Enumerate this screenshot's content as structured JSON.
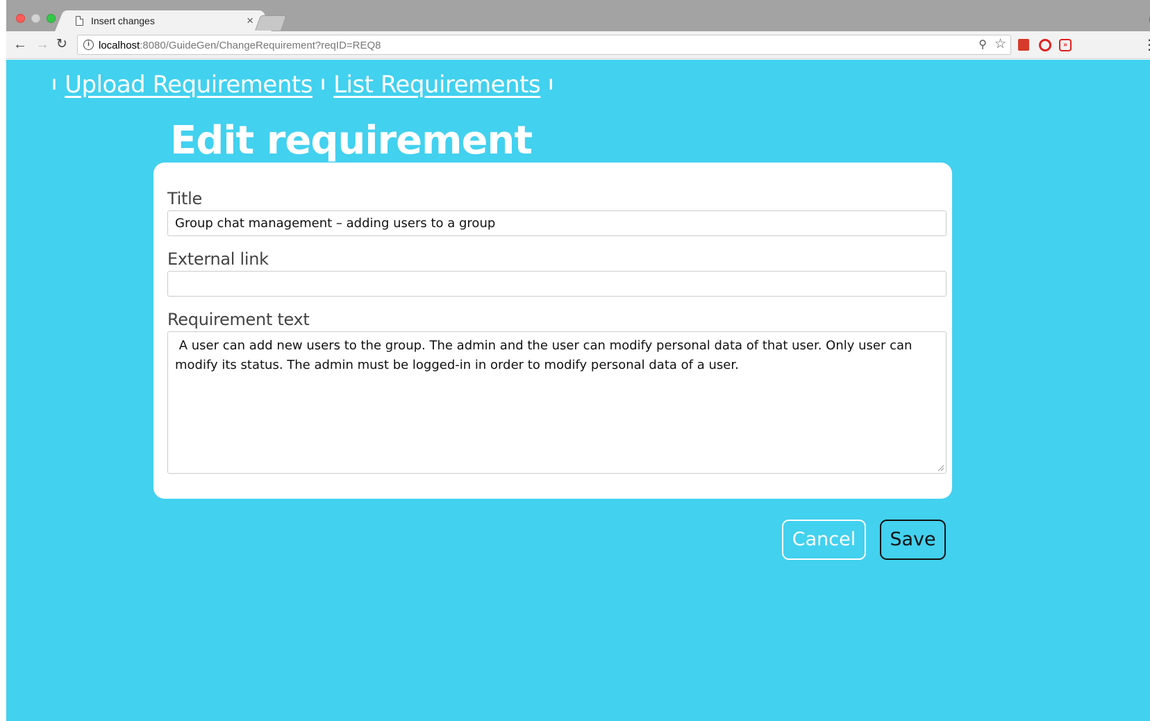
{
  "browser": {
    "tab_title": "Insert changes",
    "tab_close": "×",
    "url_host": "localhost",
    "url_rest": ":8080/GuideGen/ChangeRequirement?reqID=REQ8",
    "info_glyph": "i",
    "profile_glyph": "e",
    "ext3_glyph": "»"
  },
  "nav": {
    "separator": "I",
    "links": [
      "Upload Requirements",
      "List Requirements"
    ]
  },
  "page": {
    "heading": "Edit requirement",
    "form": {
      "title_label": "Title",
      "title_value": "Group chat management – adding users to a group",
      "link_label": "External link",
      "link_value": "",
      "text_label": "Requirement text",
      "text_value": " A user can add new users to the group. The admin and the user can modify personal data of that user. Only user can modify its status. The admin must be logged-in in order to modify personal data of a user."
    },
    "buttons": {
      "cancel": "Cancel",
      "save": "Save"
    }
  },
  "colors": {
    "page_background": "#42d1ef",
    "card_background": "#ffffff"
  }
}
